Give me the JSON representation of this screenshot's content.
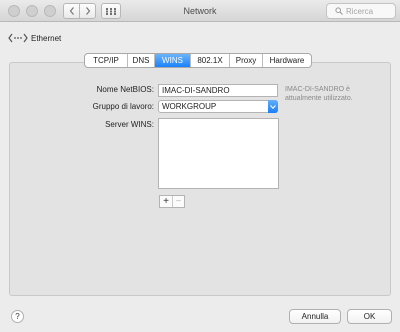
{
  "window": {
    "title": "Network",
    "search_placeholder": "Ricerca"
  },
  "breadcrumb": {
    "back_label": "Ethernet"
  },
  "tabs": [
    {
      "label": "TCP/IP",
      "active": false
    },
    {
      "label": "DNS",
      "active": false
    },
    {
      "label": "WINS",
      "active": true
    },
    {
      "label": "802.1X",
      "active": false
    },
    {
      "label": "Proxy",
      "active": false
    },
    {
      "label": "Hardware",
      "active": false
    }
  ],
  "form": {
    "netbios_label": "Nome NetBIOS:",
    "netbios_value": "IMAC-DI-SANDRO",
    "netbios_hint": "IMAC-DI-SANDRO è attualmente utilizzato.",
    "workgroup_label": "Gruppo di lavoro:",
    "workgroup_value": "WORKGROUP",
    "servers_label": "Server WINS:",
    "servers": []
  },
  "footer": {
    "help_label": "?",
    "cancel_label": "Annulla",
    "ok_label": "OK"
  },
  "icons": {
    "back": "chevron-left-icon",
    "forward": "chevron-right-icon",
    "grid": "grid-icon",
    "search": "search-icon",
    "ethernet": "ethernet-icon",
    "dropdown": "chevron-down-icon"
  },
  "colors": {
    "accent": "#1a82fb"
  }
}
